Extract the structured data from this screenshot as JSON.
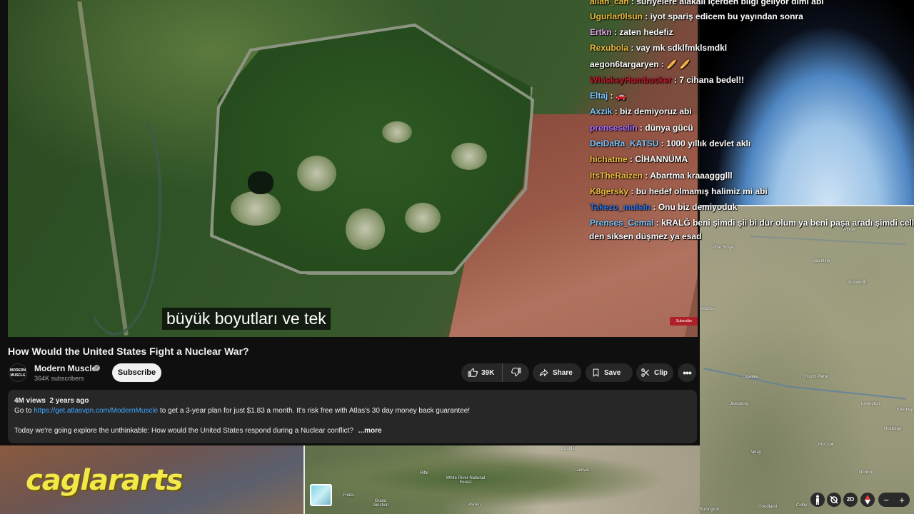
{
  "video": {
    "subtitle": "büyük boyutları ve tek",
    "title": "How Would the United States Fight a Nuclear War?",
    "watermark": "Subscribe"
  },
  "channel": {
    "avatar_text": "MODERN MUSCLE",
    "name": "Modern Muscle",
    "subscribers": "364K subscribers",
    "subscribe_label": "Subscribe"
  },
  "actions": {
    "likes": "39K",
    "share": "Share",
    "save": "Save",
    "clip": "Clip"
  },
  "description": {
    "views": "4M views",
    "age": "2 years ago",
    "line1_prefix": "Go to",
    "link": "https://get.atlasvpn.com/ModernMuscle",
    "line1_suffix": "to get a 3-year plan for just $1.83 a month. It's risk free with Atlas's 30 day money back guarantee!",
    "line2": "Today we're going explore the unthinkable: How would the United States respond during a Nuclear conflict?",
    "more": "...more"
  },
  "chat": [
    {
      "user": "allah_can",
      "text": "süriyelere alakalı içerden bilgi geliyor dimi abi",
      "color": "#f0c040"
    },
    {
      "user": "Ugurlar0lsun",
      "text": "iyot spariş edicem bu yayından sonra",
      "color": "#f0c040"
    },
    {
      "user": "Ertkn",
      "text": "zaten hedefiz",
      "color": "#e6a8f0"
    },
    {
      "user": "Rexubola",
      "text": "vay mk sdklfmklsmdkl",
      "color": "#f0c040"
    },
    {
      "user": "aegon6targaryen",
      "text": "🥖 🥖",
      "color": "#ffffff"
    },
    {
      "user": "WhiskeyHumbucker",
      "text": "7 cihana bedel!!",
      "color": "#c0182a"
    },
    {
      "user": "Eltaj",
      "text": "🚗",
      "color": "#7fc8ff"
    },
    {
      "user": "Axzik",
      "text": "biz demiyoruz abi",
      "color": "#7fc8ff"
    },
    {
      "user": "prenseselin",
      "text": "dünya gücü",
      "color": "#b070ff"
    },
    {
      "user": "DeiDaRa_KATSU",
      "text": "1000 yıllık devlet aklı",
      "color": "#7fc8ff"
    },
    {
      "user": "hichatme",
      "text": "CİHANNÜMA",
      "color": "#f0c040"
    },
    {
      "user": "ItsTheRaizen",
      "text": "Abartma kraaaggglll",
      "color": "#f0c040"
    },
    {
      "user": "K8gersky",
      "text": "bu hedef olmamış halimiz mi abi",
      "color": "#f0c040"
    },
    {
      "user": "Takezo_mulsin",
      "text": "Onu biz demiyoduk",
      "color": "#2f6fe0"
    },
    {
      "user": "Prenses_Cemal",
      "text": "kRALĞ beni şimdi şii bi dur olum ya beni paşa aradı şimdi cell",
      "color": "#7fc8ff"
    }
  ],
  "chat_continuation": "den siksen düşmez ya esad",
  "map_labels": {
    "winner": "Winner",
    "pine_ridge": "Pine Ridge",
    "valentine": "Valentine",
    "ainsworth": "Ainsworth",
    "alliance": "Alliance",
    "ogallala": "Ogallala",
    "north_platte": "North Platte",
    "julesburg": "Julesburg",
    "lexington": "Lexington",
    "kearney": "Kearney",
    "holdrege": "Holdrege",
    "mccook": "McCook",
    "wray": "Wray",
    "norton": "Norton",
    "goodland": "Goodland",
    "colby": "Colby",
    "burlington": "Burlington",
    "boulder": "Boulder",
    "denver": "Denver",
    "rifle": "Rifle",
    "white_river": "White River National Forest",
    "fruita": "Fruita",
    "grand_junction": "Grand Junction",
    "aspen": "Aspen"
  },
  "map_controls": {
    "view_2d": "2D",
    "zoom_out": "−",
    "zoom_in": "+"
  },
  "streamer": {
    "logo_text": "caglararts"
  }
}
